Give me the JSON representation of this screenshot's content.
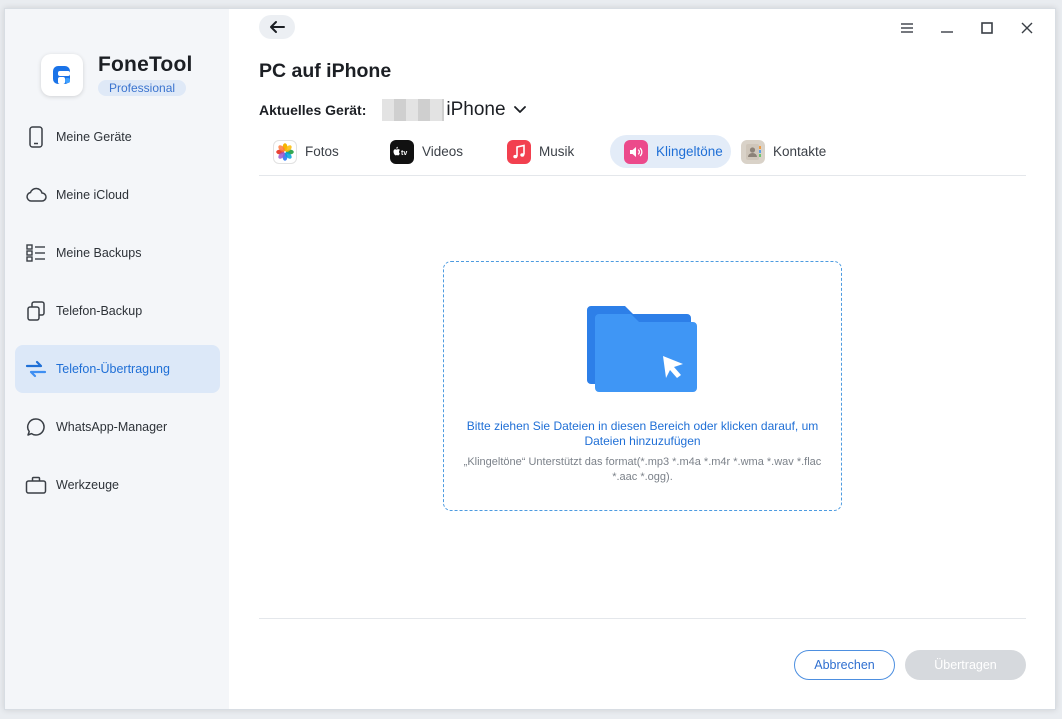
{
  "brand": {
    "name": "FoneTool",
    "badge": "Professional"
  },
  "sidebar": {
    "items": [
      {
        "label": "Meine Geräte",
        "icon": "phone-icon",
        "active": false
      },
      {
        "label": "Meine iCloud",
        "icon": "cloud-icon",
        "active": false
      },
      {
        "label": "Meine Backups",
        "icon": "list-icon",
        "active": false
      },
      {
        "label": "Telefon-Backup",
        "icon": "copy-icon",
        "active": false
      },
      {
        "label": "Telefon-Übertragung",
        "icon": "transfer-icon",
        "active": true
      },
      {
        "label": "WhatsApp-Manager",
        "icon": "chat-bubble-icon",
        "active": false
      },
      {
        "label": "Werkzeuge",
        "icon": "briefcase-icon",
        "active": false
      }
    ]
  },
  "header": {
    "title": "PC auf iPhone"
  },
  "device": {
    "label": "Aktuelles Gerät:",
    "name": "iPhone"
  },
  "tabs": [
    {
      "label": "Fotos",
      "icon": "photos-icon",
      "active": false
    },
    {
      "label": "Videos",
      "icon": "apple-tv-icon",
      "active": false
    },
    {
      "label": "Musik",
      "icon": "music-icon",
      "active": false
    },
    {
      "label": "Klingeltöne",
      "icon": "speaker-icon",
      "active": true
    },
    {
      "label": "Kontakte",
      "icon": "contacts-icon",
      "active": false
    }
  ],
  "dropzone": {
    "main_text": "Bitte ziehen Sie Dateien in diesen Bereich oder klicken darauf, um Dateien hinzuzufügen",
    "sub_text": "„Klingeltöne“ Unterstützt das format(*.mp3 *.m4a *.m4r *.wma *.wav *.flac *.aac *.ogg)."
  },
  "footer": {
    "cancel_label": "Abbrechen",
    "transfer_label": "Übertragen"
  },
  "colors": {
    "accent": "#1f6fd6",
    "active_bg": "#dce8f8",
    "ringtone": "#ec4a8b",
    "music": "#f2404f"
  }
}
